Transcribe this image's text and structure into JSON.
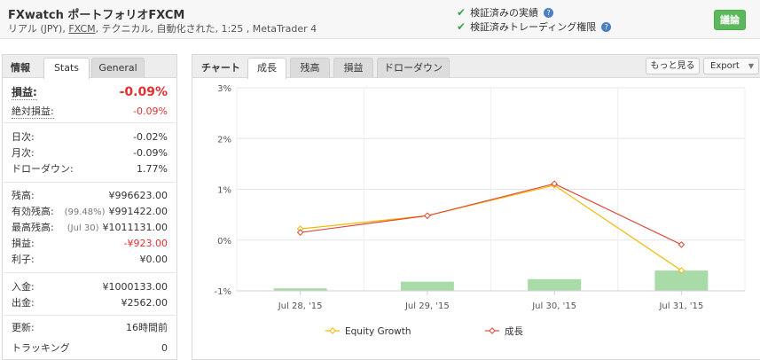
{
  "header": {
    "title": "FXwatch ポートフォリオFXCM",
    "subtitle_prefix": "リアル (JPY), ",
    "subtitle_link": "FXCM",
    "subtitle_suffix": ", テクニカル, 自動化された, 1:25 , MetaTrader 4",
    "verified_track_record": "検証済みの実績",
    "verified_trading_privileges": "検証済みトレーディング権限",
    "discuss_button": "議論",
    "help_glyph": "?"
  },
  "left_panel": {
    "tab_label": "情報",
    "tabs": [
      {
        "label": "Stats"
      },
      {
        "label": "General"
      }
    ],
    "gain": {
      "label": "損益:",
      "value": "-0.09%"
    },
    "abs_gain": {
      "label": "絶対損益:",
      "value": "-0.09%"
    },
    "daily": {
      "label": "日次:",
      "value": "-0.02%"
    },
    "monthly": {
      "label": "月次:",
      "value": "-0.09%"
    },
    "drawdown": {
      "label": "ドローダウン:",
      "value": "1.77%"
    },
    "balance": {
      "label": "残高:",
      "value": "¥996623.00"
    },
    "equity": {
      "label": "有効残高:",
      "note": "(99.48%)",
      "value": "¥991422.00"
    },
    "highest": {
      "label": "最高残高:",
      "note": "(Jul 30)",
      "value": "¥1011131.00"
    },
    "profit": {
      "label": "損益:",
      "value": "-¥923.00"
    },
    "interest": {
      "label": "利子:",
      "value": "¥0.00"
    },
    "deposits": {
      "label": "入金:",
      "value": "¥1000133.00"
    },
    "withdrawals": {
      "label": "出金:",
      "value": "¥2562.00"
    },
    "updated": {
      "label": "更新:",
      "value": "16時間前"
    },
    "tracking": {
      "label": "トラッキング",
      "value": "0"
    }
  },
  "right_panel": {
    "tab_label": "チャート",
    "tabs": [
      {
        "label": "成長"
      },
      {
        "label": "残高"
      },
      {
        "label": "損益"
      },
      {
        "label": "ドローダウン"
      }
    ],
    "more_button": "もっと見る",
    "export_button": "Export",
    "export_caret": "▼"
  },
  "colors": {
    "equity_growth": "#f5b800",
    "growth": "#e04a3c",
    "bars": "#a8dba8",
    "loss_red": "#e03030",
    "accent_green": "#5cb85c"
  },
  "chart_data": {
    "type": "line",
    "categories": [
      "Jul 28, '15",
      "Jul 29, '15",
      "Jul 30, '15",
      "Jul 31, '15"
    ],
    "series": [
      {
        "name": "Equity Growth",
        "type": "line",
        "values": [
          0.22,
          0.48,
          1.08,
          -0.6
        ]
      },
      {
        "name": "成長",
        "type": "line",
        "values": [
          0.15,
          0.48,
          1.11,
          -0.09
        ]
      },
      {
        "type": "bar",
        "values": [
          -0.95,
          -0.82,
          -0.77,
          -0.6
        ]
      }
    ],
    "ylim": [
      -1,
      3
    ],
    "yticks": [
      3,
      2,
      1,
      0,
      -1
    ],
    "ytick_labels": [
      "3%",
      "2%",
      "1%",
      "0%",
      "-1%"
    ],
    "grid": true,
    "legend": "bottom"
  }
}
